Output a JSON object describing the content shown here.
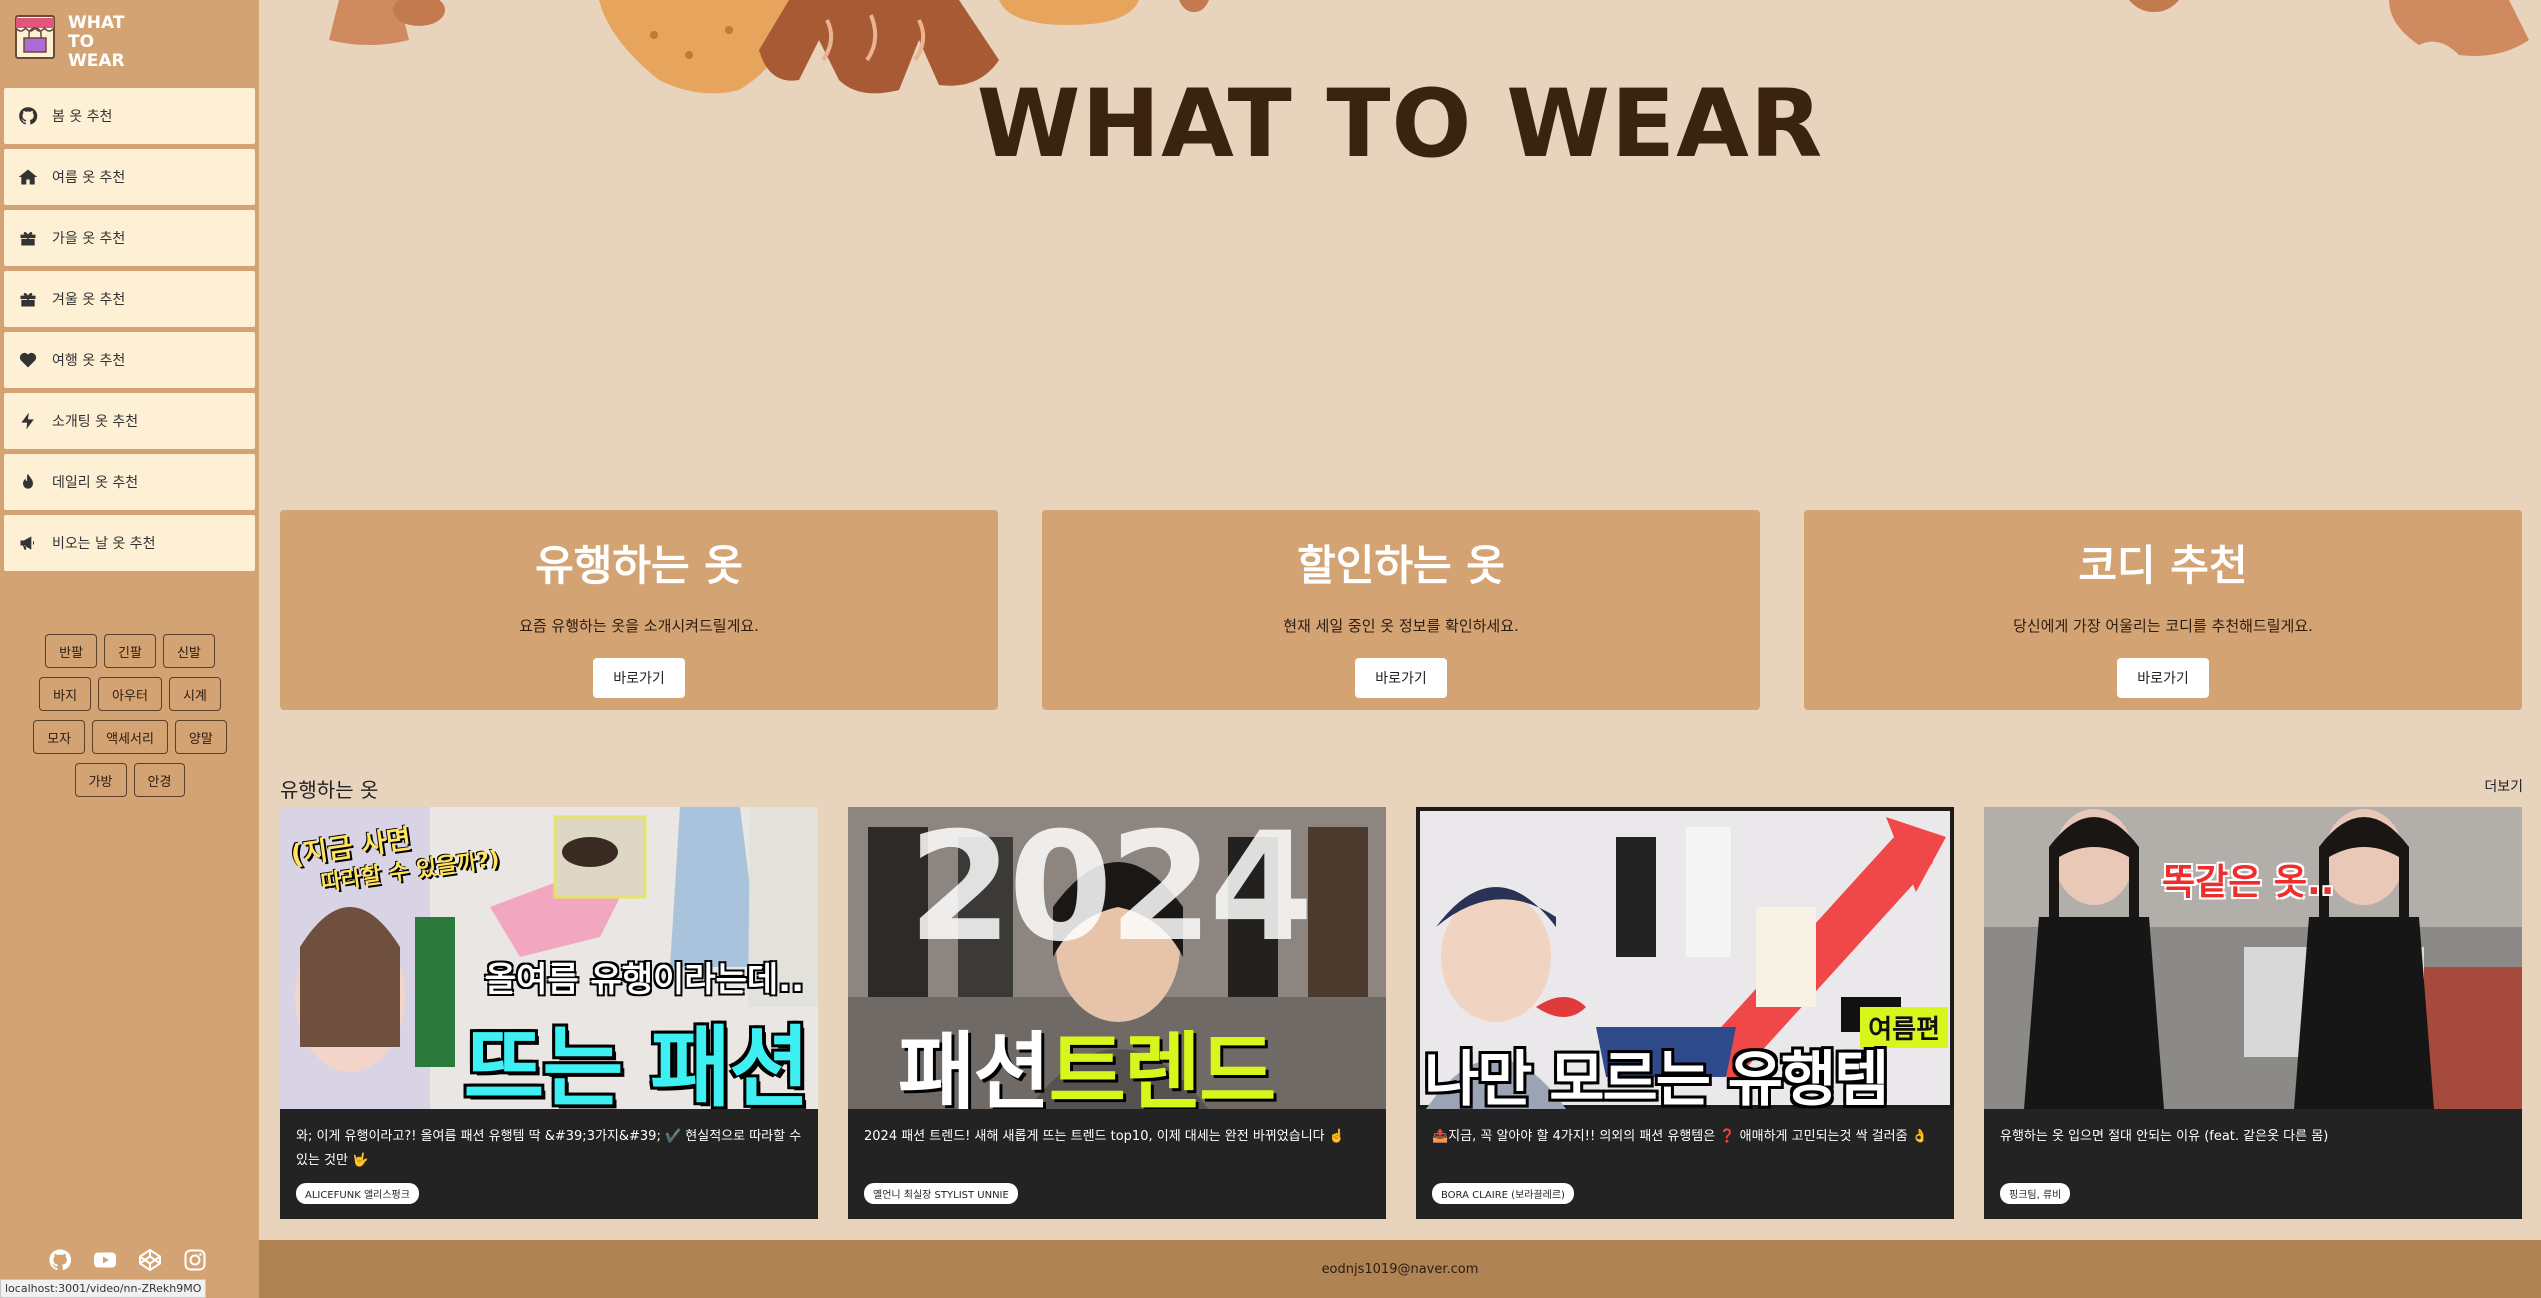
{
  "brand": {
    "line1": "WHAT",
    "line2": "TO",
    "line3": "WEAR"
  },
  "nav": {
    "items": [
      {
        "label": "봄 옷 추천",
        "icon": "github-icon"
      },
      {
        "label": "여름 옷 추천",
        "icon": "home-icon"
      },
      {
        "label": "가을 옷 추천",
        "icon": "gift-icon"
      },
      {
        "label": "겨울 옷 추천",
        "icon": "gift-icon"
      },
      {
        "label": "여행 옷 추천",
        "icon": "heart-icon"
      },
      {
        "label": "소개팅 옷 추천",
        "icon": "bolt-icon"
      },
      {
        "label": "데일리 옷 추천",
        "icon": "fire-icon"
      },
      {
        "label": "비오는 날 옷 추천",
        "icon": "megaphone-icon"
      }
    ]
  },
  "categories": [
    "반팔",
    "긴팔",
    "신발",
    "바지",
    "아우터",
    "시계",
    "모자",
    "액세서리",
    "양말",
    "가방",
    "안경"
  ],
  "socials": [
    "github-icon",
    "youtube-icon",
    "codepen-icon",
    "instagram-icon"
  ],
  "status_url": "localhost:3001/video/nn-ZRekh9MO",
  "hero": {
    "title": "WHAT TO WEAR"
  },
  "features": [
    {
      "title": "유행하는 옷",
      "desc": "요즘 유행하는 옷을 소개시켜드릴게요.",
      "button": "바로가기"
    },
    {
      "title": "할인하는 옷",
      "desc": "현재 세일 중인 옷 정보를 확인하세요.",
      "button": "바로가기"
    },
    {
      "title": "코디 추천",
      "desc": "당신에게 가장 어울리는 코디를 추천해드릴게요.",
      "button": "바로가기"
    }
  ],
  "trending": {
    "heading": "유행하는 옷",
    "more": "더보기",
    "videos": [
      {
        "thumb_top": "(지금 사면",
        "thumb_top2": "따라할 수 있을까?)",
        "thumb_mid": "올여름 유행이라는데..",
        "thumb_big": "뜨는 패션",
        "title": "와; 이게 유행이라고?! 올여름 패션 유행템 딱 &#39;3가지&#39; ✔️ 현실적으로 따라할 수 있는 것만 🤟",
        "channel": "ALICEFUNK 앨리스펑크"
      },
      {
        "thumb_top": "2024",
        "thumb_big_a": "패션",
        "thumb_big_b": "트렌드",
        "title": "2024 패션 트렌드! 새해 새롭게 뜨는 트렌드 top10, 이제 대세는 완전 바뀌었습니다 ☝️",
        "channel": "옐언니 최실장 STYLIST UNNIE"
      },
      {
        "thumb_tag": "여름편",
        "thumb_big": "나만 모르는 유행템",
        "title": "📤지금, 꼭 알아야 할 4가지!! 의외의 패션 유행템은 ❓ 애매하게 고민되는것 싹 걸러줌 👌",
        "channel": "BORA CLAIRE (보라끌레르)"
      },
      {
        "thumb_top": "똑같은 옷..",
        "title": "유행하는 옷 입으면 절대 안되는 이유 (feat. 같은옷 다른 몸)",
        "channel": "핑크팀, 류비"
      }
    ]
  },
  "footer": {
    "email": "eodnjs1019@naver.com"
  },
  "colors": {
    "page_bg": "#e8d3bc",
    "sidebar_bg": "#d4a373",
    "nav_item_bg": "#fdf0d5",
    "card_bg": "#232323",
    "footer_bg": "#b08354",
    "title_color": "#3a2410"
  }
}
